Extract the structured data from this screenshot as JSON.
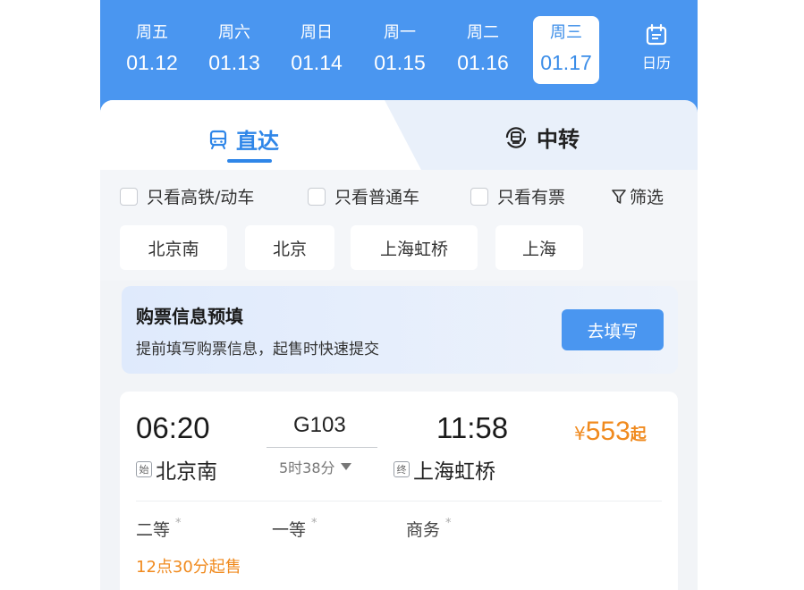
{
  "date_bar": {
    "days": [
      {
        "weekday": "周五",
        "date": "01.12"
      },
      {
        "weekday": "周六",
        "date": "01.13"
      },
      {
        "weekday": "周日",
        "date": "01.14"
      },
      {
        "weekday": "周一",
        "date": "01.15"
      },
      {
        "weekday": "周二",
        "date": "01.16"
      },
      {
        "weekday": "周三",
        "date": "01.17",
        "selected": true
      }
    ],
    "calendar_label": "日历"
  },
  "tabs": {
    "direct": "直达",
    "transfer": "中转"
  },
  "filters": {
    "high_speed": "只看高铁/动车",
    "regular": "只看普通车",
    "available": "只看有票",
    "filter_label": "筛选"
  },
  "stations": [
    "北京南",
    "北京",
    "上海虹桥",
    "上海"
  ],
  "banner": {
    "title": "购票信息预填",
    "subtitle": "提前填写购票信息，起售时快速提交",
    "button": "去填写"
  },
  "train": {
    "departure_time": "06:20",
    "departure_tag": "始",
    "departure_station": "北京南",
    "number": "G103",
    "duration": "5时38分",
    "arrival_time": "11:58",
    "arrival_tag": "终",
    "arrival_station": "上海虹桥",
    "price_currency": "¥",
    "price": "553",
    "price_suffix": "起",
    "seats": [
      {
        "name": "二等",
        "mark": "*"
      },
      {
        "name": "一等",
        "mark": "*"
      },
      {
        "name": "商务",
        "mark": "*"
      }
    ],
    "sale_time": "12点30分起售"
  },
  "colors": {
    "primary": "#4a96f0",
    "accent": "#2f86e8",
    "price": "#f08a1e"
  }
}
